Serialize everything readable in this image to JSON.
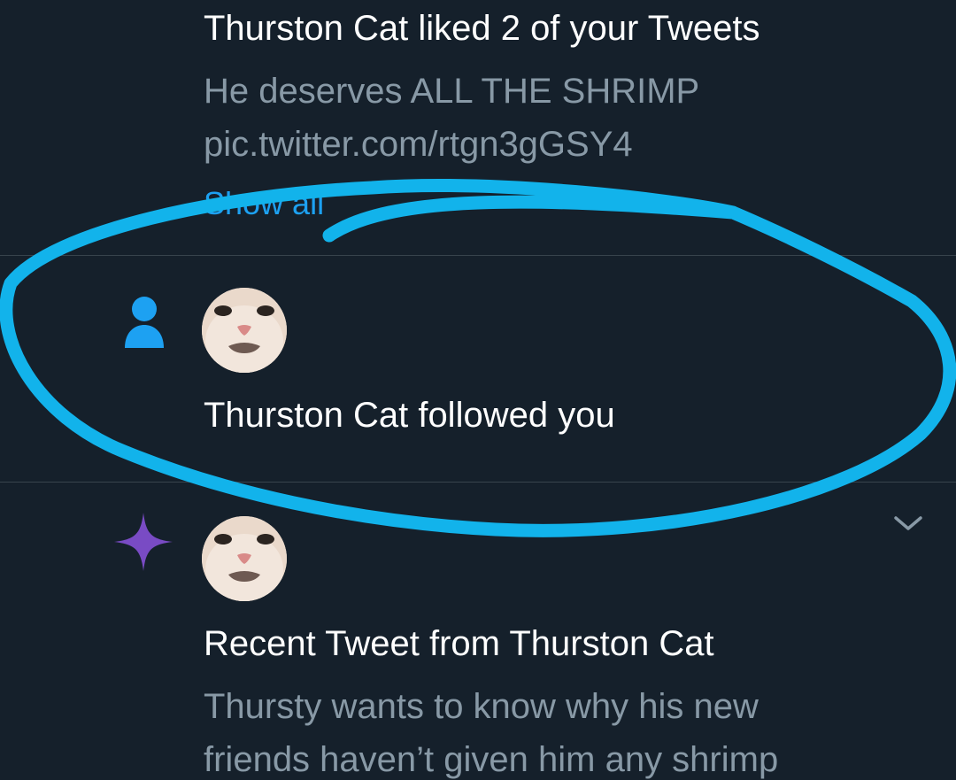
{
  "notifications": [
    {
      "kind": "likes",
      "text": "Thurston Cat liked 2 of your Tweets",
      "tweet_line1": "He deserves ALL THE SHRIMP",
      "tweet_line2": "pic.twitter.com/rtgn3gGSY4",
      "show_all": "Show all"
    },
    {
      "kind": "follow",
      "icon": "person-icon",
      "avatar": "thurston-cat-avatar",
      "text": "Thurston Cat followed you"
    },
    {
      "kind": "recent-tweet",
      "icon": "sparkle-icon",
      "avatar": "thurston-cat-avatar",
      "text": "Recent Tweet from Thurston Cat",
      "tweet_line1": "Thursty wants to know why his new",
      "tweet_line2": "friends haven’t given him any shrimp",
      "menu_icon": "chevron-down-icon"
    }
  ],
  "colors": {
    "background": "#15202b",
    "primary_text": "#ffffff",
    "secondary_text": "#8899a6",
    "link": "#1da1f2",
    "follow_icon": "#1da1f2",
    "sparkle_icon": "#794bc4",
    "divider": "#38444d",
    "annotation_circle": "#12b3eb"
  }
}
